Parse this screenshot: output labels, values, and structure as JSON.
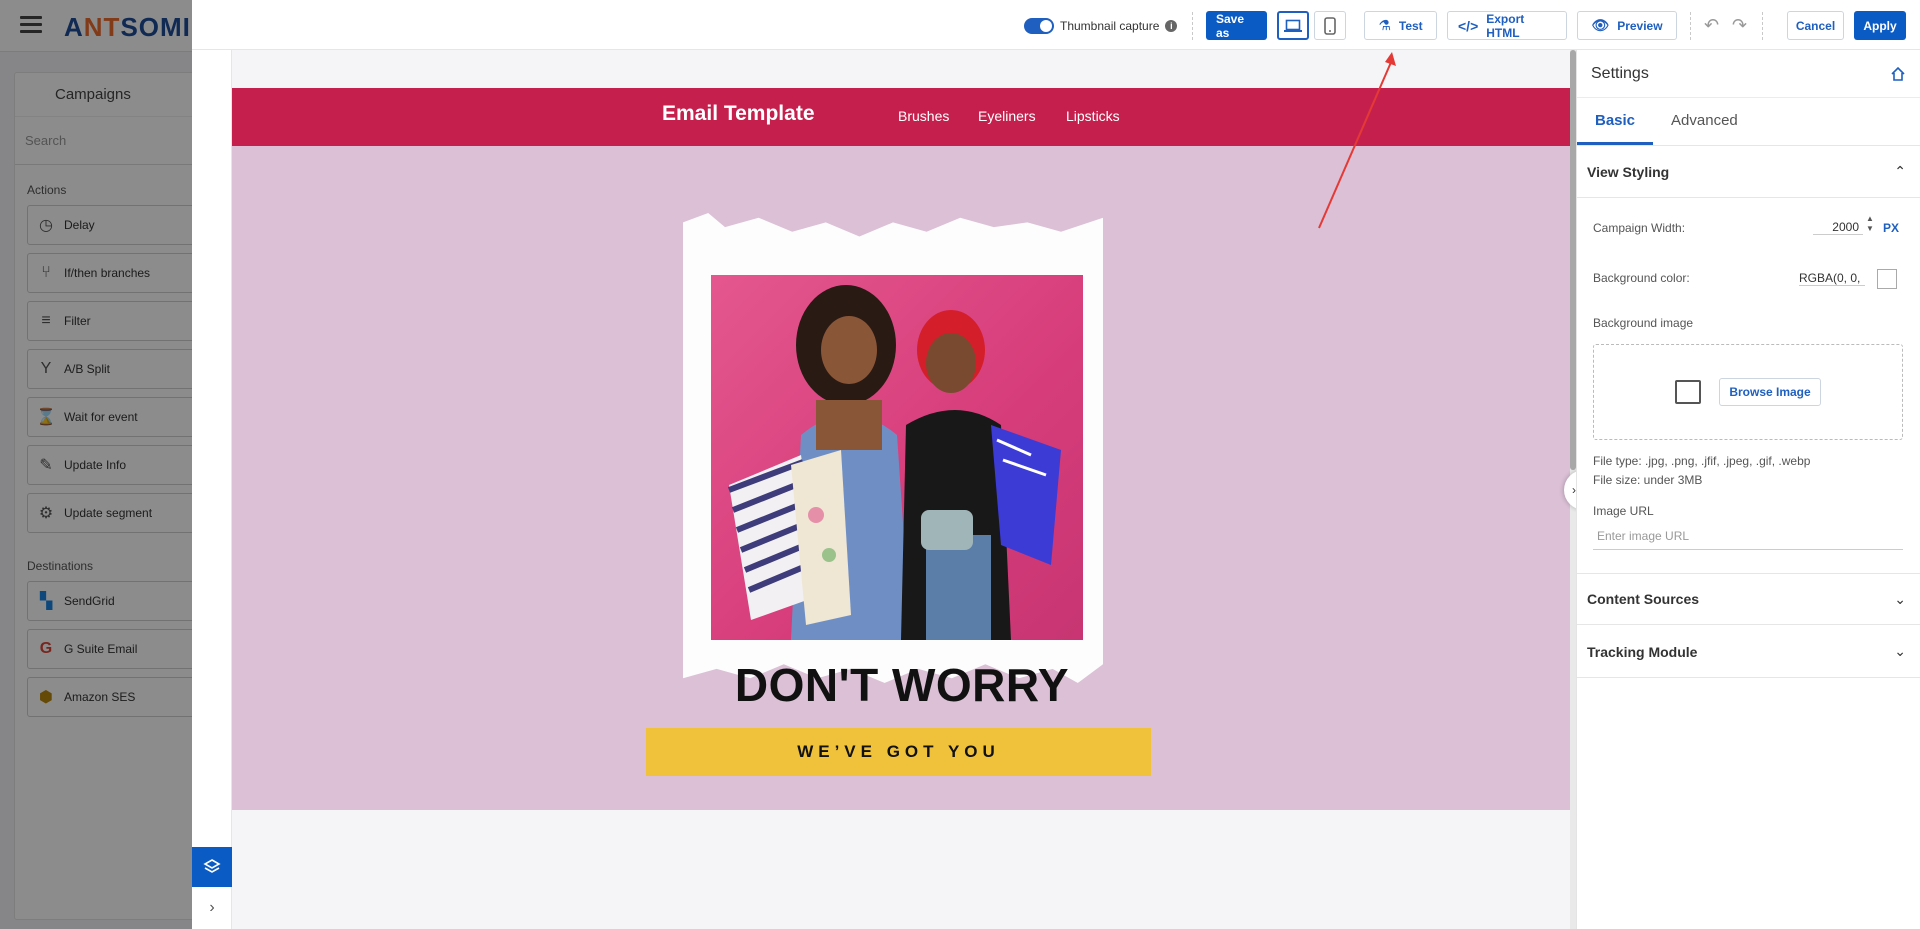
{
  "background_app": {
    "logo": "ANTSOMI",
    "panel_title": "Campaigns",
    "search_placeholder": "Search",
    "actions_label": "Actions",
    "actions": [
      "Delay",
      "If/then branches",
      "Filter",
      "A/B Split",
      "Wait for event",
      "Update Info",
      "Update segment"
    ],
    "destinations_label": "Destinations",
    "destinations": [
      "SendGrid",
      "G Suite Email",
      "Amazon SES"
    ]
  },
  "toolbar": {
    "thumbnail_label": "Thumbnail capture",
    "thumbnail_on": true,
    "save_as": "Save as",
    "test": "Test",
    "export_html": "Export HTML",
    "preview": "Preview",
    "cancel": "Cancel",
    "apply": "Apply"
  },
  "email": {
    "title": "Email Template",
    "nav": [
      "Brushes",
      "Eyeliners",
      "Lipsticks"
    ],
    "headline": "DON'T WORRY",
    "banner": "WE’VE GOT YOU",
    "header_color": "#c5204d",
    "body_color": "#dbc0d6",
    "banner_color": "#f0c23b"
  },
  "settings": {
    "title": "Settings",
    "tabs": [
      "Basic",
      "Advanced"
    ],
    "active_tab": "Basic",
    "view_styling": "View Styling",
    "campaign_width_label": "Campaign Width:",
    "campaign_width": "2000",
    "unit": "PX",
    "bg_color_label": "Background color:",
    "bg_color_value": "RGBA(0, 0,",
    "bg_image_label": "Background image",
    "browse_image": "Browse Image",
    "file_type": "File type: .jpg, .png, .jfif, .jpeg, .gif, .webp",
    "file_size": "File size: under 3MB",
    "image_url_label": "Image URL",
    "image_url_placeholder": "Enter image URL",
    "content_sources": "Content Sources",
    "tracking_module": "Tracking Module"
  }
}
